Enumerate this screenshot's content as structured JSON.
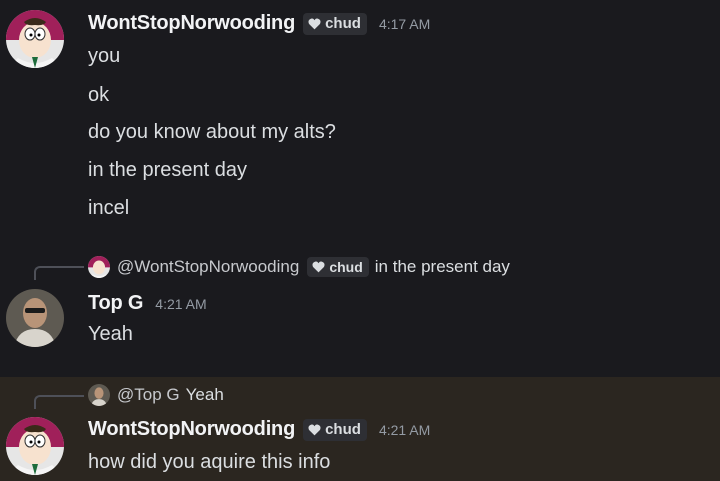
{
  "group1": {
    "username": "WontStopNorwooding",
    "tag": "chud",
    "time": "4:17 AM",
    "lines": [
      "you",
      "ok",
      "do you know about my alts?",
      "in the present day",
      "incel"
    ]
  },
  "group2": {
    "reply": {
      "mention": "@WontStopNorwooding",
      "tag": "chud",
      "text": "in the present day"
    },
    "username": "Top G",
    "time": "4:21 AM",
    "line": "Yeah"
  },
  "group3": {
    "reply": {
      "mention": "@Top G",
      "text": "Yeah"
    },
    "username": "WontStopNorwooding",
    "tag": "chud",
    "time": "4:21 AM",
    "line": "how did you aquire this info"
  },
  "icons": {
    "tag_icon": "heart-icon",
    "avatar1": "peter-avatar",
    "avatar2": "topg-avatar"
  }
}
